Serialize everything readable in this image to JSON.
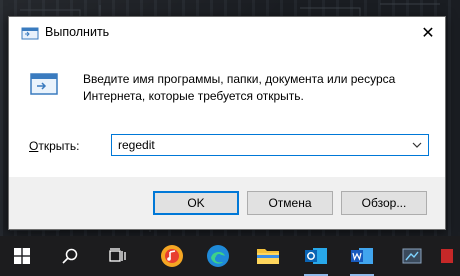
{
  "dialog": {
    "title": "Выполнить",
    "close_glyph": "✕",
    "description": "Введите имя программы, папки, документа или ресурса Интернета, которые требуется открыть.",
    "open_label_underlined": "О",
    "open_label_rest": "ткрыть:",
    "input_value": "regedit",
    "buttons": {
      "ok": "OK",
      "cancel": "Отмена",
      "browse": "Обзор..."
    }
  },
  "taskbar": {
    "items": [
      "start-icon",
      "search-icon",
      "task-view-icon",
      "music-app-icon",
      "edge-icon",
      "file-explorer-icon",
      "outlook-icon",
      "word-icon",
      "app-icon"
    ],
    "colors": {
      "background": "#1c1c1e",
      "accent": "#0078d7"
    }
  }
}
